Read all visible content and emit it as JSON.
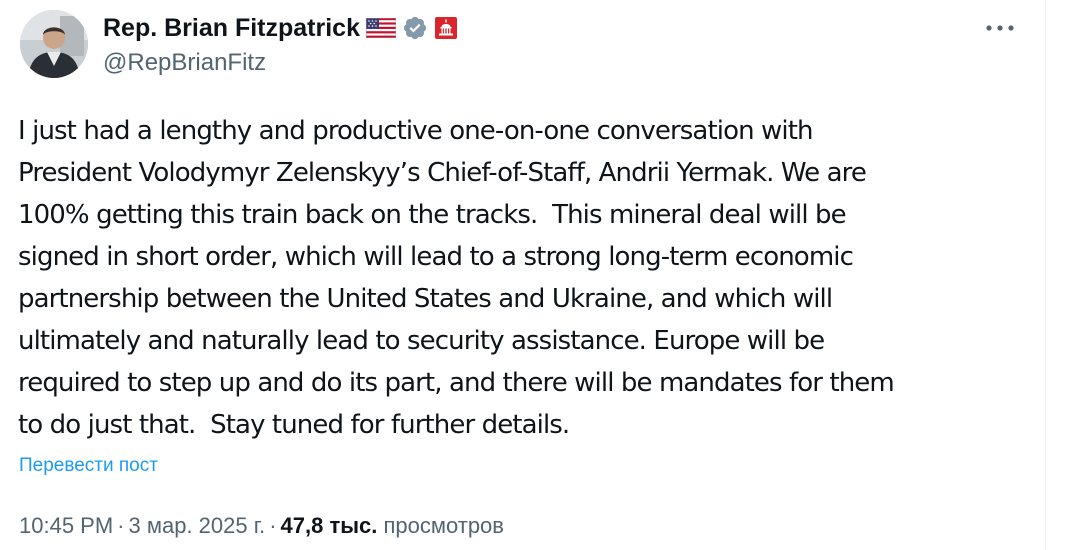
{
  "author": {
    "display_name": "Rep. Brian Fitzpatrick",
    "handle": "@RepBrianFitz",
    "flag_icon": "us-flag-icon",
    "verified_icon": "verified-badge-icon",
    "affiliate_icon": "capitol-badge-icon",
    "verified_color": "#829aab",
    "affiliate_color": "#d9262c"
  },
  "menu": {
    "icon": "more-icon"
  },
  "tweet": {
    "lines": [
      "I just had a lengthy and productive one-on-one conversation with",
      "President Volodymyr Zelenskyy’s Chief-of-Staff, Andrii Yermak. We are",
      "100% getting this train back on the tracks.  This mineral deal will be",
      "signed in short order, which will lead to a strong long-term economic",
      "partnership between the United States and Ukraine, and which will",
      "ultimately and naturally lead to security assistance. Europe will be",
      "required to step up and do its part, and there will be mandates for them",
      "to do just that.  Stay tuned for further details."
    ],
    "translate_label": "Перевести пост"
  },
  "meta": {
    "time": "10:45 PM",
    "separator": "·",
    "date": "3 мар. 2025 г.",
    "views_count": "47,8 тыс.",
    "views_label": "просмотров"
  },
  "colors": {
    "text": "#0f1419",
    "secondary": "#536471",
    "link": "#1d9bf0"
  }
}
